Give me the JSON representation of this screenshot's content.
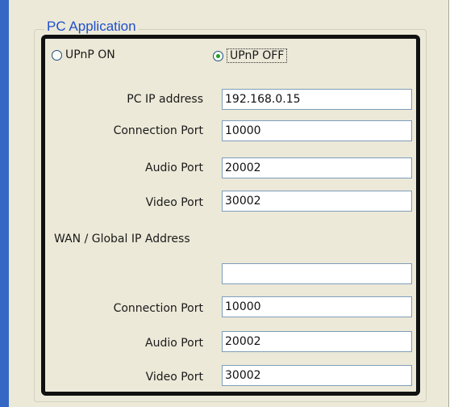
{
  "group": {
    "title": "PC Application"
  },
  "upnp": {
    "on_label": "UPnP ON",
    "off_label": "UPnP OFF",
    "selected": "off"
  },
  "pc": {
    "ip_label": "PC IP address",
    "ip_value": "192.168.0.15",
    "connection_label": "Connection Port",
    "connection_value": "10000",
    "audio_label": "Audio Port",
    "audio_value": "20002",
    "video_label": "Video Port",
    "video_value": "30002"
  },
  "wan": {
    "heading": "WAN / Global IP Address",
    "ip_value": "",
    "connection_label": "Connection Port",
    "connection_value": "10000",
    "audio_label": "Audio Port",
    "audio_value": "20002",
    "video_label": "Video Port",
    "video_value": "30002"
  }
}
